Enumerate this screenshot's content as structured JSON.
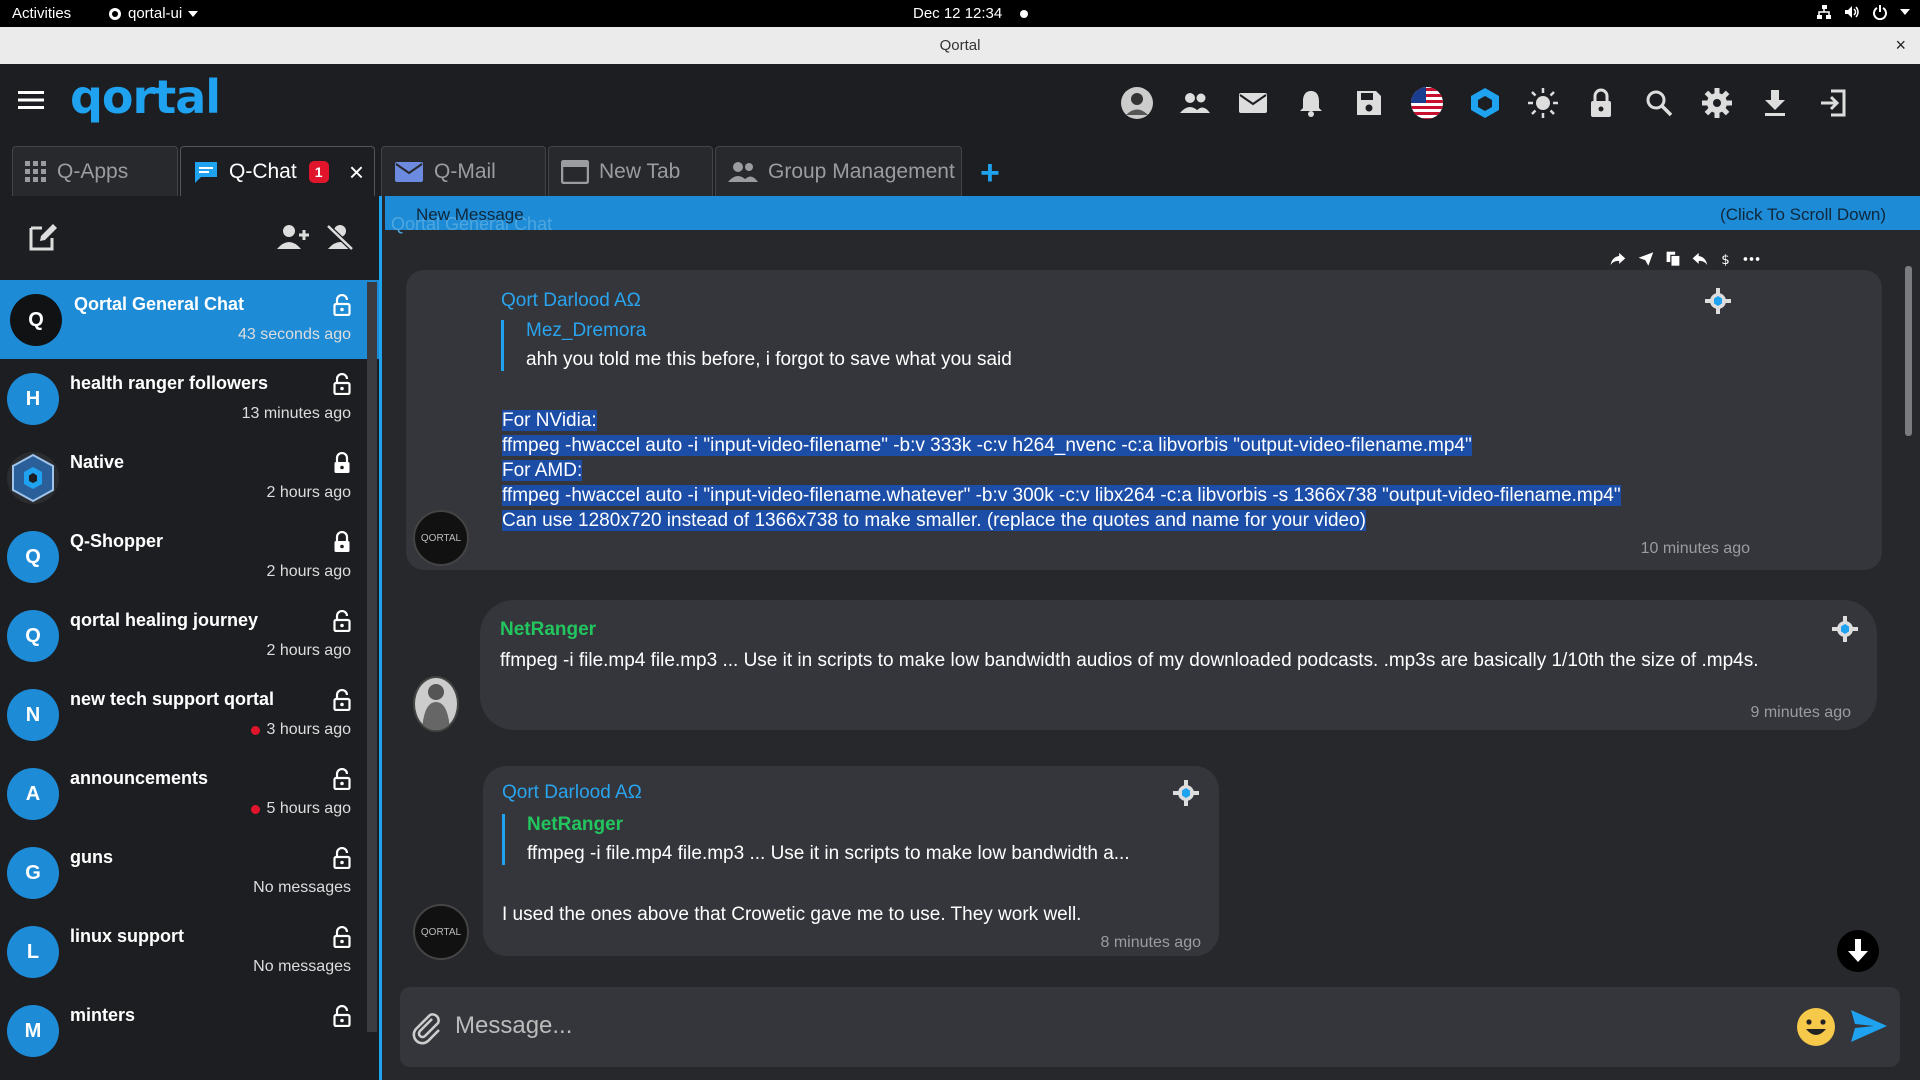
{
  "system": {
    "activities": "Activities",
    "app_menu": "qortal-ui",
    "clock": "Dec 12  12:34"
  },
  "window": {
    "title": "Qortal",
    "close": "×"
  },
  "header": {
    "logo": "qortal"
  },
  "tabs": [
    {
      "label": "Q-Apps",
      "icon": "apps-grid-icon"
    },
    {
      "label": "Q-Chat",
      "icon": "chat-bubble-icon",
      "badge": "1",
      "active": true
    },
    {
      "label": "Q-Mail",
      "icon": "mail-icon"
    },
    {
      "label": "New Tab",
      "icon": "window-icon"
    },
    {
      "label": "Group Management",
      "icon": "group-icon"
    }
  ],
  "tab_plus": "+",
  "tab_close": "×",
  "sidebar": {
    "chats": [
      {
        "initial": "Q",
        "name": "Qortal General Chat",
        "time": "43 seconds ago",
        "active": true,
        "locked": false,
        "unread": false
      },
      {
        "initial": "H",
        "name": "health ranger followers",
        "time": "13 minutes ago",
        "locked": false,
        "unread": false
      },
      {
        "initial": "",
        "name": "Native",
        "time": "2 hours ago",
        "locked": true,
        "unread": false
      },
      {
        "initial": "Q",
        "name": "Q-Shopper",
        "time": "2 hours ago",
        "locked": true,
        "unread": false
      },
      {
        "initial": "Q",
        "name": "qortal healing journey",
        "time": "2 hours ago",
        "locked": false,
        "unread": false
      },
      {
        "initial": "N",
        "name": "new tech support qortal",
        "time": "3 hours ago",
        "locked": false,
        "unread": true
      },
      {
        "initial": "A",
        "name": "announcements",
        "time": "5 hours ago",
        "locked": false,
        "unread": true
      },
      {
        "initial": "G",
        "name": "guns",
        "time": "No messages",
        "locked": false,
        "unread": false
      },
      {
        "initial": "L",
        "name": "linux support",
        "time": "No messages",
        "locked": false,
        "unread": false
      },
      {
        "initial": "M",
        "name": "minters",
        "time": "",
        "locked": false,
        "unread": false
      }
    ]
  },
  "chat": {
    "banner_left": "New Message",
    "banner_ghost": "Qortal General Chat",
    "banner_right": "(Click To Scroll Down)",
    "messages": [
      {
        "sender": "Qort Darlood AΩ",
        "quote_sender": "Mez_Dremora",
        "quote_text": "ahh you told me this before, i forgot to save what you said",
        "lines": [
          "For NVidia:",
          "ffmpeg -hwaccel auto -i \"input-video-filename\" -b:v 333k -c:v h264_nvenc -c:a libvorbis \"output-video-filename.mp4\"",
          "For AMD:",
          "ffmpeg -hwaccel auto -i \"input-video-filename.whatever\" -b:v 300k -c:v libx264 -c:a libvorbis -s 1366x738 \"output-video-filename.mp4\"",
          "Can use 1280x720 instead of 1366x738 to make smaller.  (replace the quotes and name for your video)"
        ],
        "time": "10 minutes ago",
        "avatar_label": "QORTAL"
      },
      {
        "sender": "NetRanger",
        "text": "ffmpeg -i file.mp4 file.mp3 ... Use it in scripts to make low bandwidth audios of my downloaded podcasts. .mp3s are basically 1/10th the size of .mp4s.",
        "time": "9 minutes ago"
      },
      {
        "sender": "Qort Darlood AΩ",
        "quote_sender": "NetRanger",
        "quote_text": "ffmpeg -i file.mp4 file.mp3 ... Use it in scripts to make low bandwidth a...",
        "text": "I used the ones above that Crowetic gave me to use. They work well.",
        "time": "8 minutes ago",
        "avatar_label": "QORTAL"
      }
    ]
  },
  "composer": {
    "placeholder": "Message..."
  },
  "colors": {
    "accent": "#1fa2ef",
    "selection": "#1c4ea8",
    "unread": "#e0152c",
    "green_sender": "#22c55e"
  }
}
